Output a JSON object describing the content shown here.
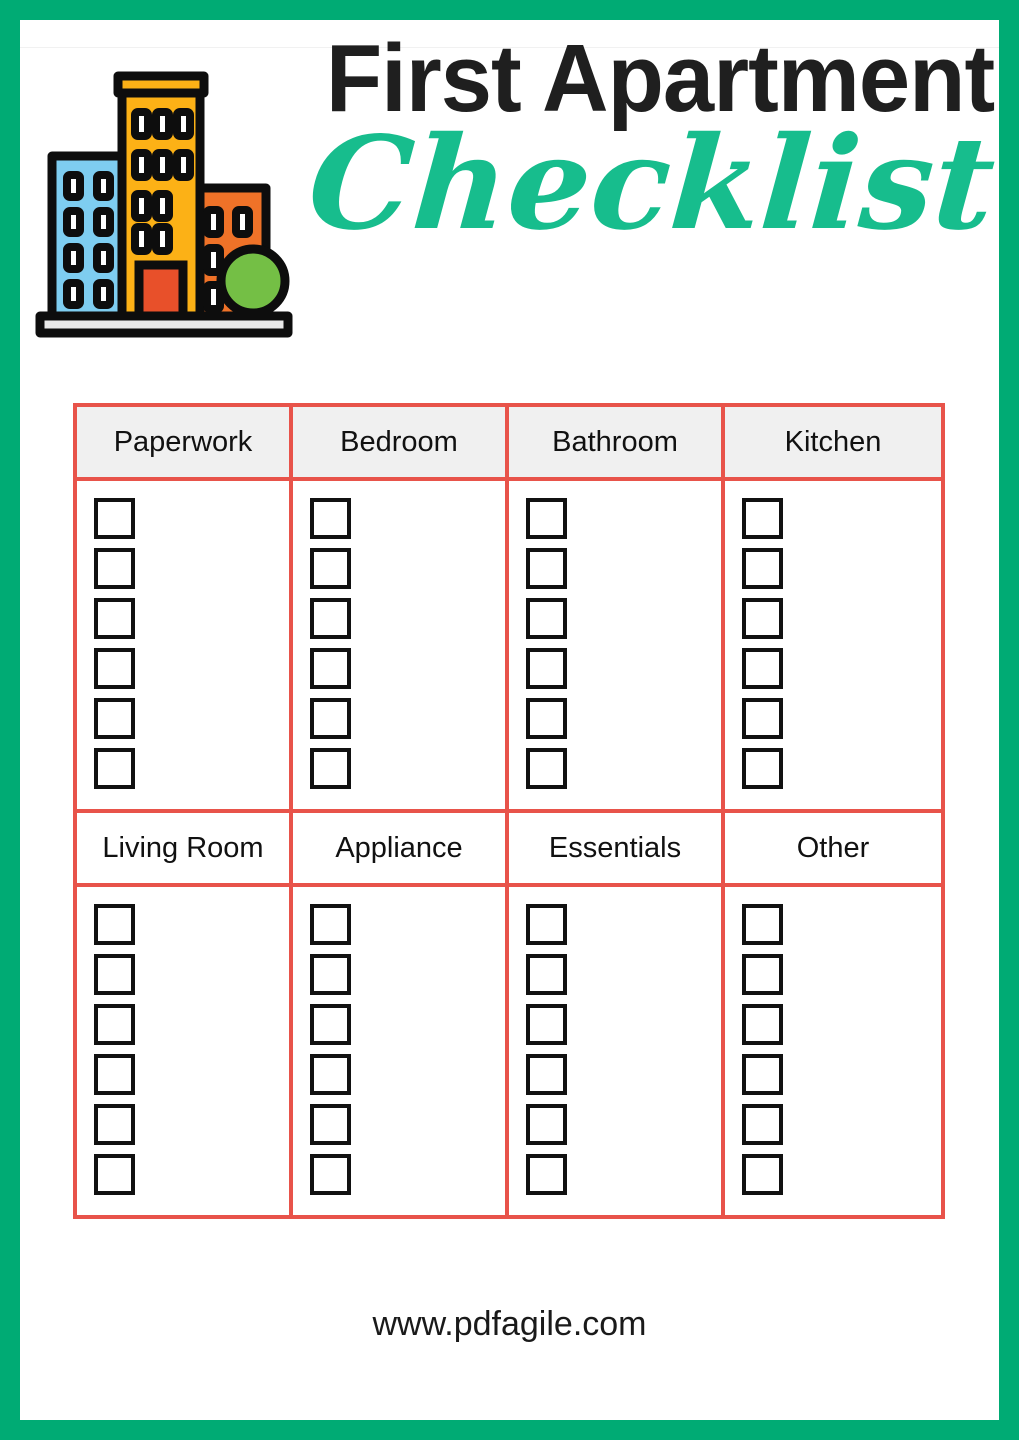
{
  "colors": {
    "page_border_green": "#00ab74",
    "script_green": "#17bd8d",
    "table_rule_red": "#e8534a",
    "header_shade": "#f0f0f0",
    "checkbox_border": "#111111",
    "title_text": "#1f1f1f"
  },
  "header": {
    "title_line1": "First Apartment",
    "title_line2": "Checklist",
    "logo_name": "apartment-buildings-illustration"
  },
  "checklist": {
    "checkbox_count_per_column": 6,
    "sections": [
      {
        "shaded_header": true,
        "columns": [
          {
            "label": "Paperwork",
            "checkboxes": 6
          },
          {
            "label": "Bedroom",
            "checkboxes": 6
          },
          {
            "label": "Bathroom",
            "checkboxes": 6
          },
          {
            "label": "Kitchen",
            "checkboxes": 6
          }
        ]
      },
      {
        "shaded_header": false,
        "columns": [
          {
            "label": "Living Room",
            "checkboxes": 6
          },
          {
            "label": "Appliance",
            "checkboxes": 6
          },
          {
            "label": "Essentials",
            "checkboxes": 6
          },
          {
            "label": "Other",
            "checkboxes": 6
          }
        ]
      }
    ]
  },
  "footer": {
    "website": "www.pdfagile.com"
  }
}
